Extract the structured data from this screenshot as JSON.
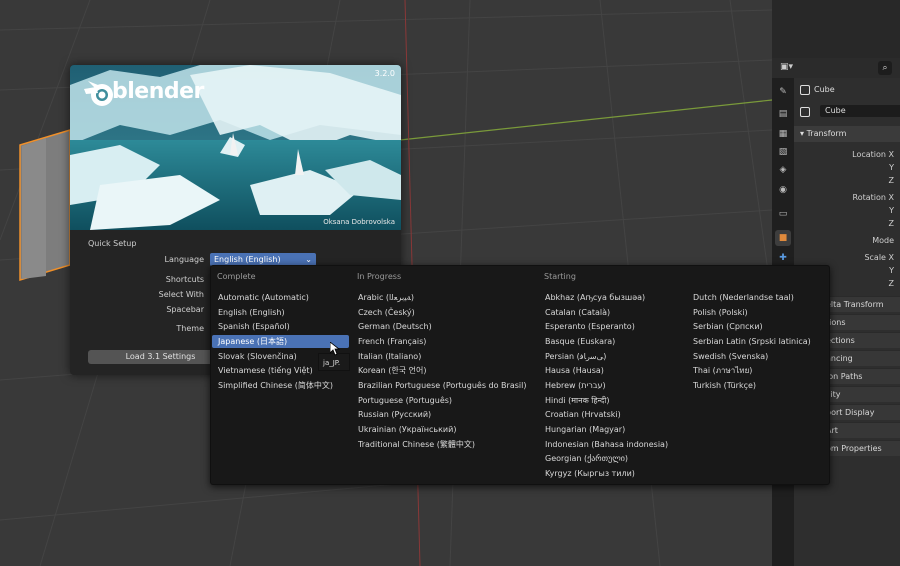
{
  "splash": {
    "version": "3.2.0",
    "logo_text": "blender",
    "credit": "Oksana Dobrovolska",
    "quick_setup_title": "Quick Setup",
    "settings": [
      {
        "label": "Language"
      },
      {
        "label": "Shortcuts"
      },
      {
        "label": "Select With"
      },
      {
        "label": "Spacebar"
      },
      {
        "label": "Theme"
      }
    ],
    "language_value": "English (English)",
    "load_button": "Load 3.1 Settings"
  },
  "language_menu": {
    "columns": [
      {
        "header": "Complete",
        "items": [
          "Automatic (Automatic)",
          "English (English)",
          "Spanish (Español)",
          "Japanese (日本語)",
          "Slovak (Slovenčina)",
          "Vietnamese (tiếng Việt)",
          "Simplified Chinese (简体中文)"
        ]
      },
      {
        "header": "In Progress",
        "items": [
          "Arabic (ﺔﻴﺑﺮﻌﻟا)",
          "Czech (Český)",
          "German (Deutsch)",
          "French (Français)",
          "Italian (Italiano)",
          "Korean (한국 언어)",
          "Brazilian Portuguese (Português do Brasil)",
          "Portuguese (Português)",
          "Russian (Русский)",
          "Ukrainian (Український)",
          "Traditional Chinese (繁體中文)"
        ]
      },
      {
        "header": "Starting",
        "items": [
          "Abkhaz (Аҧсуа бызшәа)",
          "Catalan (Català)",
          "Esperanto (Esperanto)",
          "Basque (Euskara)",
          "Persian (ﯽﺳرﺎﻓ)",
          "Hausa (Hausa)",
          "Hebrew (עברית)",
          "Hindi (मानक हिन्दी)",
          "Croatian (Hrvatski)",
          "Hungarian (Magyar)",
          "Indonesian (Bahasa indonesia)",
          "Georgian (ქართული)",
          "Kyrgyz (Кыргыз тили)"
        ]
      },
      {
        "header": "",
        "items": [
          "Dutch (Nederlandse taal)",
          "Polish (Polski)",
          "Serbian (Српски)",
          "Serbian Latin (Srpski latinica)",
          "Swedish (Svenska)",
          "Thai (ภาษาไทย)",
          "Turkish (Türkçe)"
        ]
      }
    ],
    "selected": "Japanese (日本語)",
    "tooltip": "ja_JP."
  },
  "properties": {
    "object_name": "Cube",
    "data_name": "Cube",
    "transform_section": "Transform",
    "fields": [
      "Location X",
      "Y",
      "Z",
      "Rotation X",
      "Y",
      "Z",
      "Mode",
      "Scale X",
      "Y",
      "Z"
    ],
    "subpanels": [
      "elta Transform",
      "tions",
      "ections",
      "ancing",
      "ion Paths",
      "ility",
      "port Display",
      "Art",
      "om Properties"
    ]
  },
  "colors": {
    "accent": "#4a72b5",
    "active_tab": "#e08a3c",
    "selection_outline": "#f0902a"
  }
}
